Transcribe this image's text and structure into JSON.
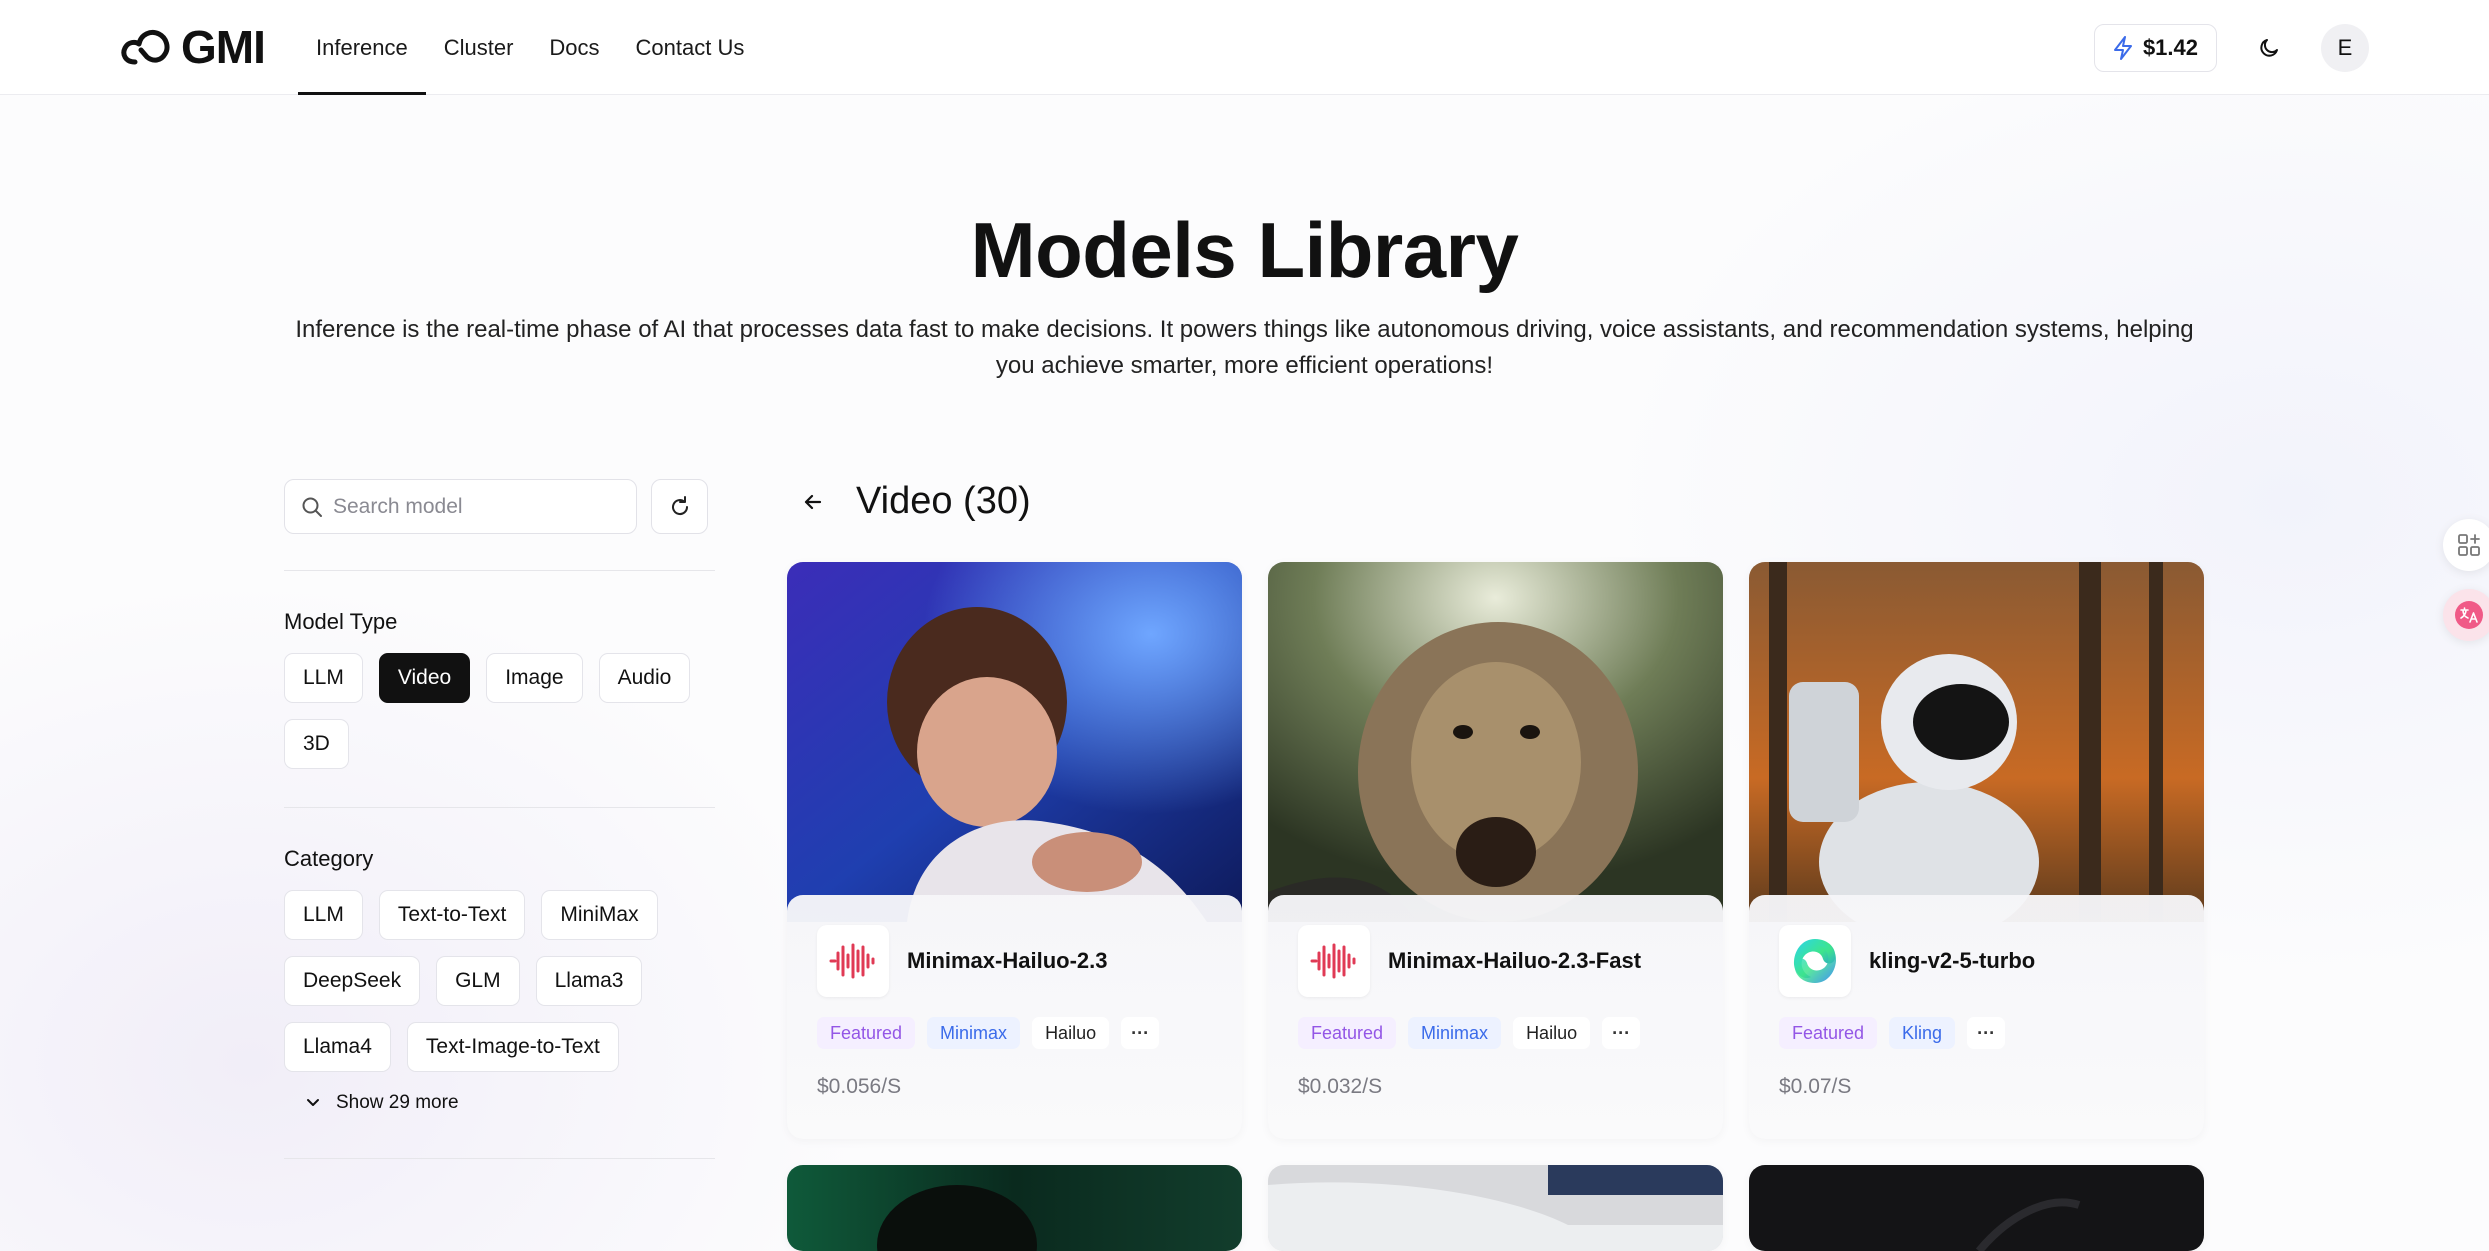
{
  "brand": {
    "name": "GMI"
  },
  "nav": {
    "links": [
      {
        "label": "Inference"
      },
      {
        "label": "Cluster"
      },
      {
        "label": "Docs"
      },
      {
        "label": "Contact Us"
      }
    ],
    "balance": "$1.42",
    "avatar_initial": "E"
  },
  "hero": {
    "title": "Models Library",
    "description": "Inference is the real-time phase of AI that processes data fast to make decisions. It powers things like autonomous driving, voice assistants, and recommendation systems, helping you achieve smarter, more efficient operations!"
  },
  "sidebar": {
    "search_placeholder": "Search model",
    "model_type": {
      "title": "Model Type",
      "options": [
        "LLM",
        "Video",
        "Image",
        "Audio",
        "3D"
      ],
      "selected": "Video"
    },
    "category": {
      "title": "Category",
      "options": [
        "LLM",
        "Text-to-Text",
        "MiniMax",
        "DeepSeek",
        "GLM",
        "Llama3",
        "Llama4",
        "Text-Image-to-Text"
      ],
      "show_more": "Show 29 more"
    }
  },
  "main": {
    "title": "Video (30)",
    "cards": [
      {
        "name": "Minimax-Hailuo-2.3",
        "tags": [
          "Featured",
          "Minimax",
          "Hailuo",
          "···"
        ],
        "price": "$0.056/S",
        "logo": "waveform-icon"
      },
      {
        "name": "Minimax-Hailuo-2.3-Fast",
        "tags": [
          "Featured",
          "Minimax",
          "Hailuo",
          "···"
        ],
        "price": "$0.032/S",
        "logo": "waveform-icon"
      },
      {
        "name": "kling-v2-5-turbo",
        "tags": [
          "Featured",
          "Kling",
          "···"
        ],
        "price": "$0.07/S",
        "logo": "kling-icon"
      }
    ]
  },
  "colors": {
    "accent_dark": "#111111",
    "featured_tag": "#9356e6",
    "brand_tag": "#3b6bea",
    "minimax_logo": "#e03a55"
  }
}
